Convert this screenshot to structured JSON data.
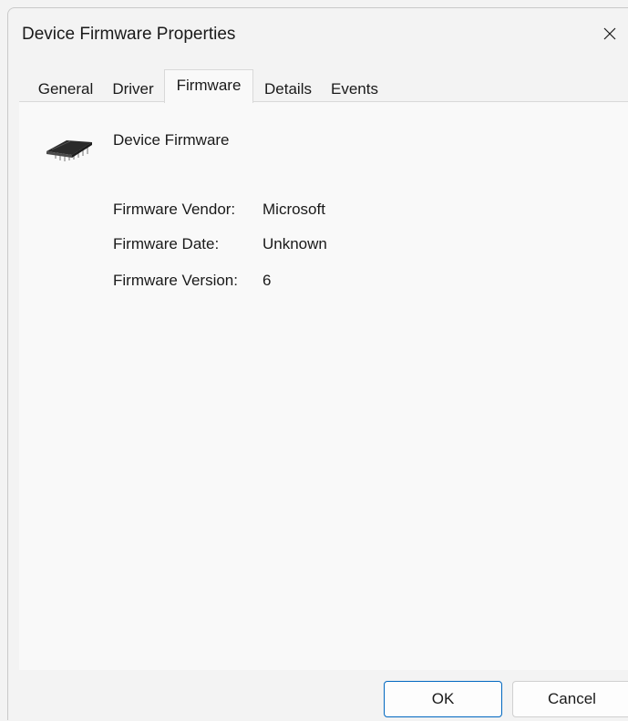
{
  "window": {
    "title": "Device Firmware Properties",
    "close_icon": "close-icon"
  },
  "tabs": [
    {
      "label": "General",
      "active": false
    },
    {
      "label": "Driver",
      "active": false
    },
    {
      "label": "Firmware",
      "active": true
    },
    {
      "label": "Details",
      "active": false
    },
    {
      "label": "Events",
      "active": false
    }
  ],
  "panel": {
    "device_icon": "chip-icon",
    "device_name": "Device Firmware",
    "properties": [
      {
        "label": "Firmware Vendor:",
        "value": "Microsoft"
      },
      {
        "label": "Firmware Date:",
        "value": "Unknown"
      },
      {
        "label": "Firmware Version:",
        "value": "6"
      }
    ]
  },
  "footer": {
    "ok_label": "OK",
    "cancel_label": "Cancel"
  },
  "colors": {
    "accent": "#0067c0",
    "background": "#f3f3f3",
    "panel": "#f9f9f9"
  }
}
